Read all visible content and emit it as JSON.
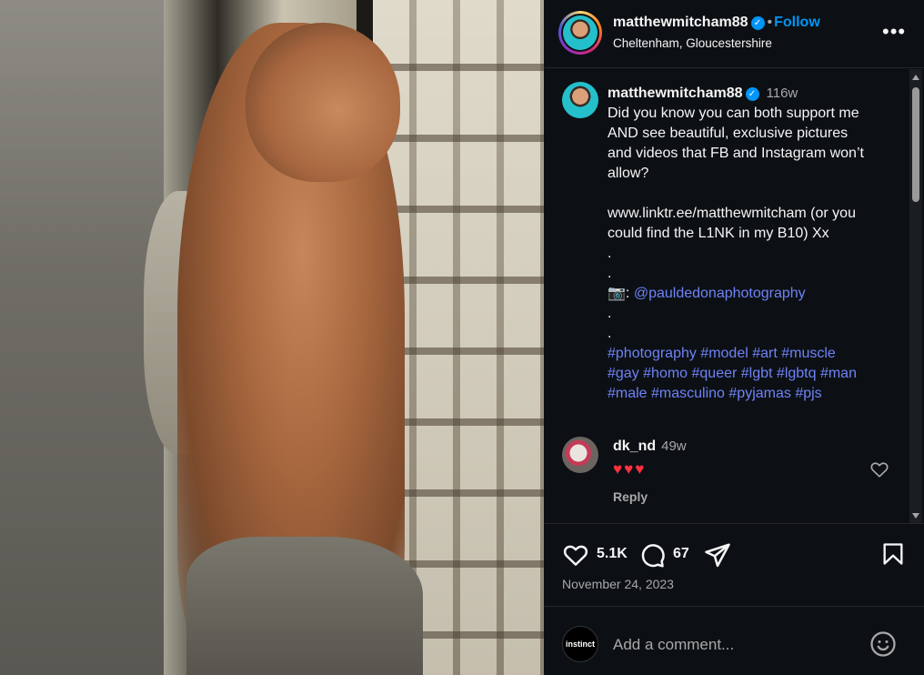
{
  "post": {
    "username": "matthewmitcham88",
    "verified_mark": "✓",
    "separator": "•",
    "follow_label": "Follow",
    "location": "Cheltenham, Gloucestershire",
    "more_label": "•••"
  },
  "caption": {
    "username": "matthewmitcham88",
    "time": "116w",
    "lines": [
      "Did you know you can both support me",
      "AND see beautiful, exclusive pictures",
      "and videos that FB and Instagram won’t",
      "allow?",
      "",
      "www.linktr.ee/matthewmitcham (or you",
      "could find the L1NK in my B10) Xx",
      ".",
      "."
    ],
    "camera_emoji": "📷",
    "camera_colon": ":",
    "photo_credit": "@pauldedonaphotography",
    "dot_lines": [
      ".",
      "."
    ],
    "hashtag_lines": [
      "#photography #model #art #muscle",
      "#gay #homo #queer #lgbt #lgbtq #man",
      "#male #masculino #pyjamas #pjs"
    ]
  },
  "comment": {
    "username": "dk_nd",
    "time": "49w",
    "text": "♥♥♥",
    "reply_label": "Reply"
  },
  "actions": {
    "likes": "5.1K",
    "comments": "67",
    "date": "November 24, 2023"
  },
  "comment_box": {
    "avatar_text": "instinct",
    "placeholder": "Add a comment..."
  },
  "colors": {
    "background": "#0c1014",
    "link": "#6f82f6",
    "follow": "#0095f6",
    "heart": "#ff3040"
  },
  "icons": [
    "more-icon",
    "verified-icon",
    "heart-icon",
    "comment-icon",
    "share-icon",
    "bookmark-icon",
    "emoji-icon"
  ]
}
